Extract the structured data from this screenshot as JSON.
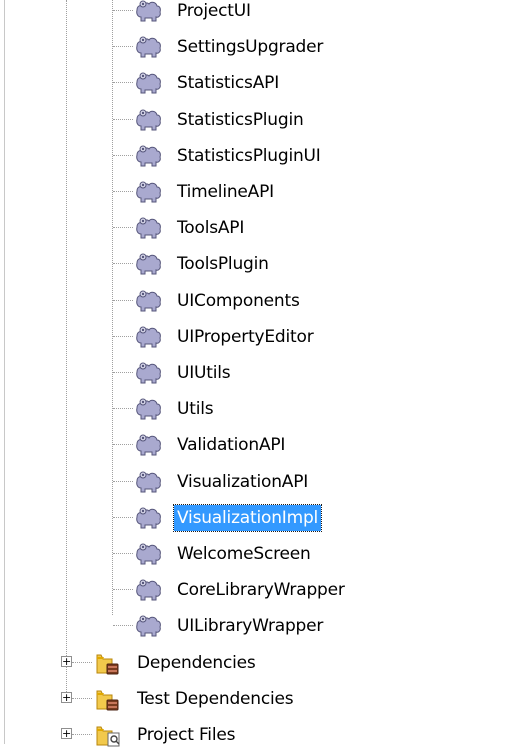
{
  "tree": {
    "modules": [
      {
        "label": "ProjectUI",
        "selected": false,
        "icon": "module-icon"
      },
      {
        "label": "SettingsUpgrader",
        "selected": false,
        "icon": "module-icon"
      },
      {
        "label": "StatisticsAPI",
        "selected": false,
        "icon": "module-icon"
      },
      {
        "label": "StatisticsPlugin",
        "selected": false,
        "icon": "module-icon"
      },
      {
        "label": "StatisticsPluginUI",
        "selected": false,
        "icon": "module-icon"
      },
      {
        "label": "TimelineAPI",
        "selected": false,
        "icon": "module-icon"
      },
      {
        "label": "ToolsAPI",
        "selected": false,
        "icon": "module-icon"
      },
      {
        "label": "ToolsPlugin",
        "selected": false,
        "icon": "module-icon"
      },
      {
        "label": "UIComponents",
        "selected": false,
        "icon": "module-icon"
      },
      {
        "label": "UIPropertyEditor",
        "selected": false,
        "icon": "module-icon"
      },
      {
        "label": "UIUtils",
        "selected": false,
        "icon": "module-icon"
      },
      {
        "label": "Utils",
        "selected": false,
        "icon": "module-icon"
      },
      {
        "label": "ValidationAPI",
        "selected": false,
        "icon": "module-icon"
      },
      {
        "label": "VisualizationAPI",
        "selected": false,
        "icon": "module-icon"
      },
      {
        "label": "VisualizationImpl",
        "selected": true,
        "icon": "module-icon"
      },
      {
        "label": "WelcomeScreen",
        "selected": false,
        "icon": "module-icon"
      },
      {
        "label": "CoreLibraryWrapper",
        "selected": false,
        "icon": "module-icon"
      },
      {
        "label": "UILibraryWrapper",
        "selected": false,
        "icon": "module-icon"
      }
    ],
    "folders": [
      {
        "label": "Dependencies",
        "expander": "+",
        "icon": "library-folder-icon"
      },
      {
        "label": "Test Dependencies",
        "expander": "+",
        "icon": "library-folder-icon"
      },
      {
        "label": "Project Files",
        "expander": "+",
        "icon": "project-files-folder-icon"
      }
    ]
  },
  "colors": {
    "selection": "#3399ff",
    "module_icon": "#a9a9cf",
    "folder": "#f2c94c"
  }
}
